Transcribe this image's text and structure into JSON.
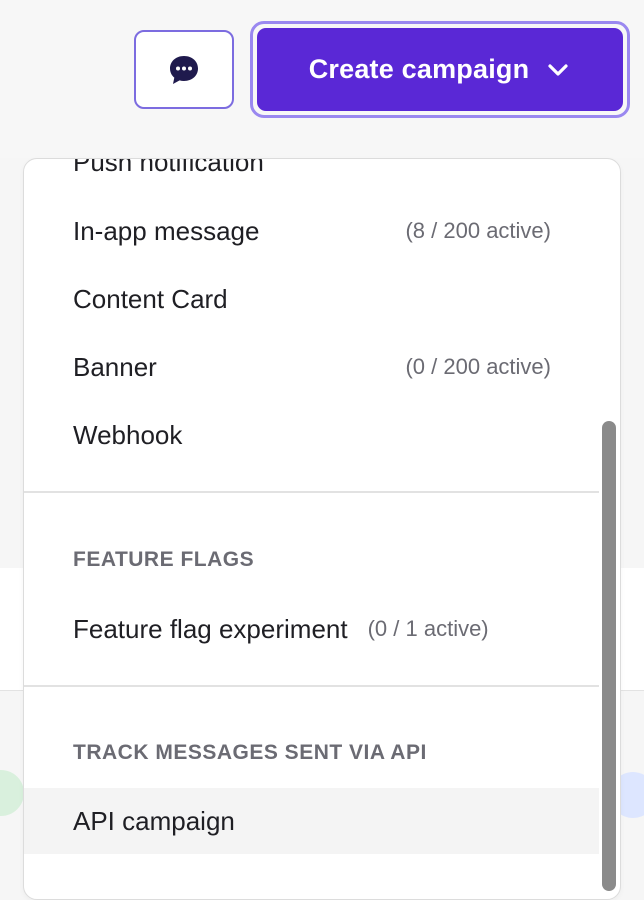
{
  "header": {
    "chat_button_icon": "chat-bubble-icon",
    "create_button_label": "Create campaign",
    "create_button_icon": "chevron-down-icon"
  },
  "menu": {
    "items_top": [
      {
        "label": "Push notification",
        "meta": ""
      },
      {
        "label": "In-app message",
        "meta": "(8 / 200 active)"
      },
      {
        "label": "Content Card",
        "meta": ""
      },
      {
        "label": "Banner",
        "meta": "(0 / 200 active)"
      },
      {
        "label": "Webhook",
        "meta": ""
      }
    ],
    "feature_flags": {
      "heading": "FEATURE FLAGS",
      "items": [
        {
          "label": "Feature flag experiment",
          "meta": "(0 / 1 active)"
        }
      ]
    },
    "track_api": {
      "heading": "TRACK MESSAGES SENT VIA API",
      "items": [
        {
          "label": "API campaign",
          "meta": ""
        }
      ]
    }
  },
  "colors": {
    "accent": "#5a28d6",
    "accent_outline": "#9a88f0"
  }
}
